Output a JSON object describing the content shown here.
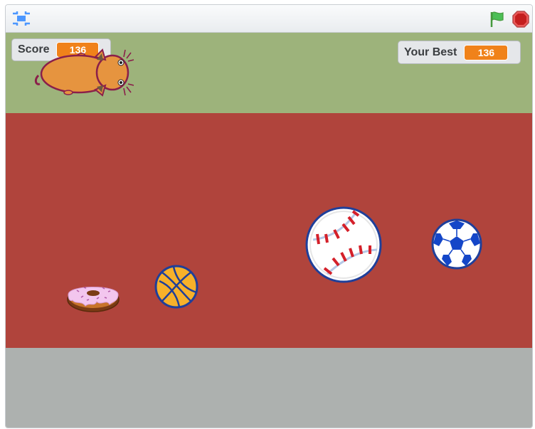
{
  "toolbar": {
    "fullscreen_icon": "fullscreen-icon",
    "flag_icon": "green-flag-icon",
    "stop_icon": "stop-icon"
  },
  "monitors": {
    "score": {
      "label": "Score",
      "value": "136"
    },
    "best": {
      "label": "Your Best",
      "value": "136"
    }
  },
  "colors": {
    "sky": "#9db37b",
    "track": "#b0443c",
    "floor": "#adb1af",
    "monitor_value": "#f0821a"
  },
  "sprites": [
    "hamster",
    "donut",
    "basketball",
    "baseball",
    "soccer-ball"
  ]
}
